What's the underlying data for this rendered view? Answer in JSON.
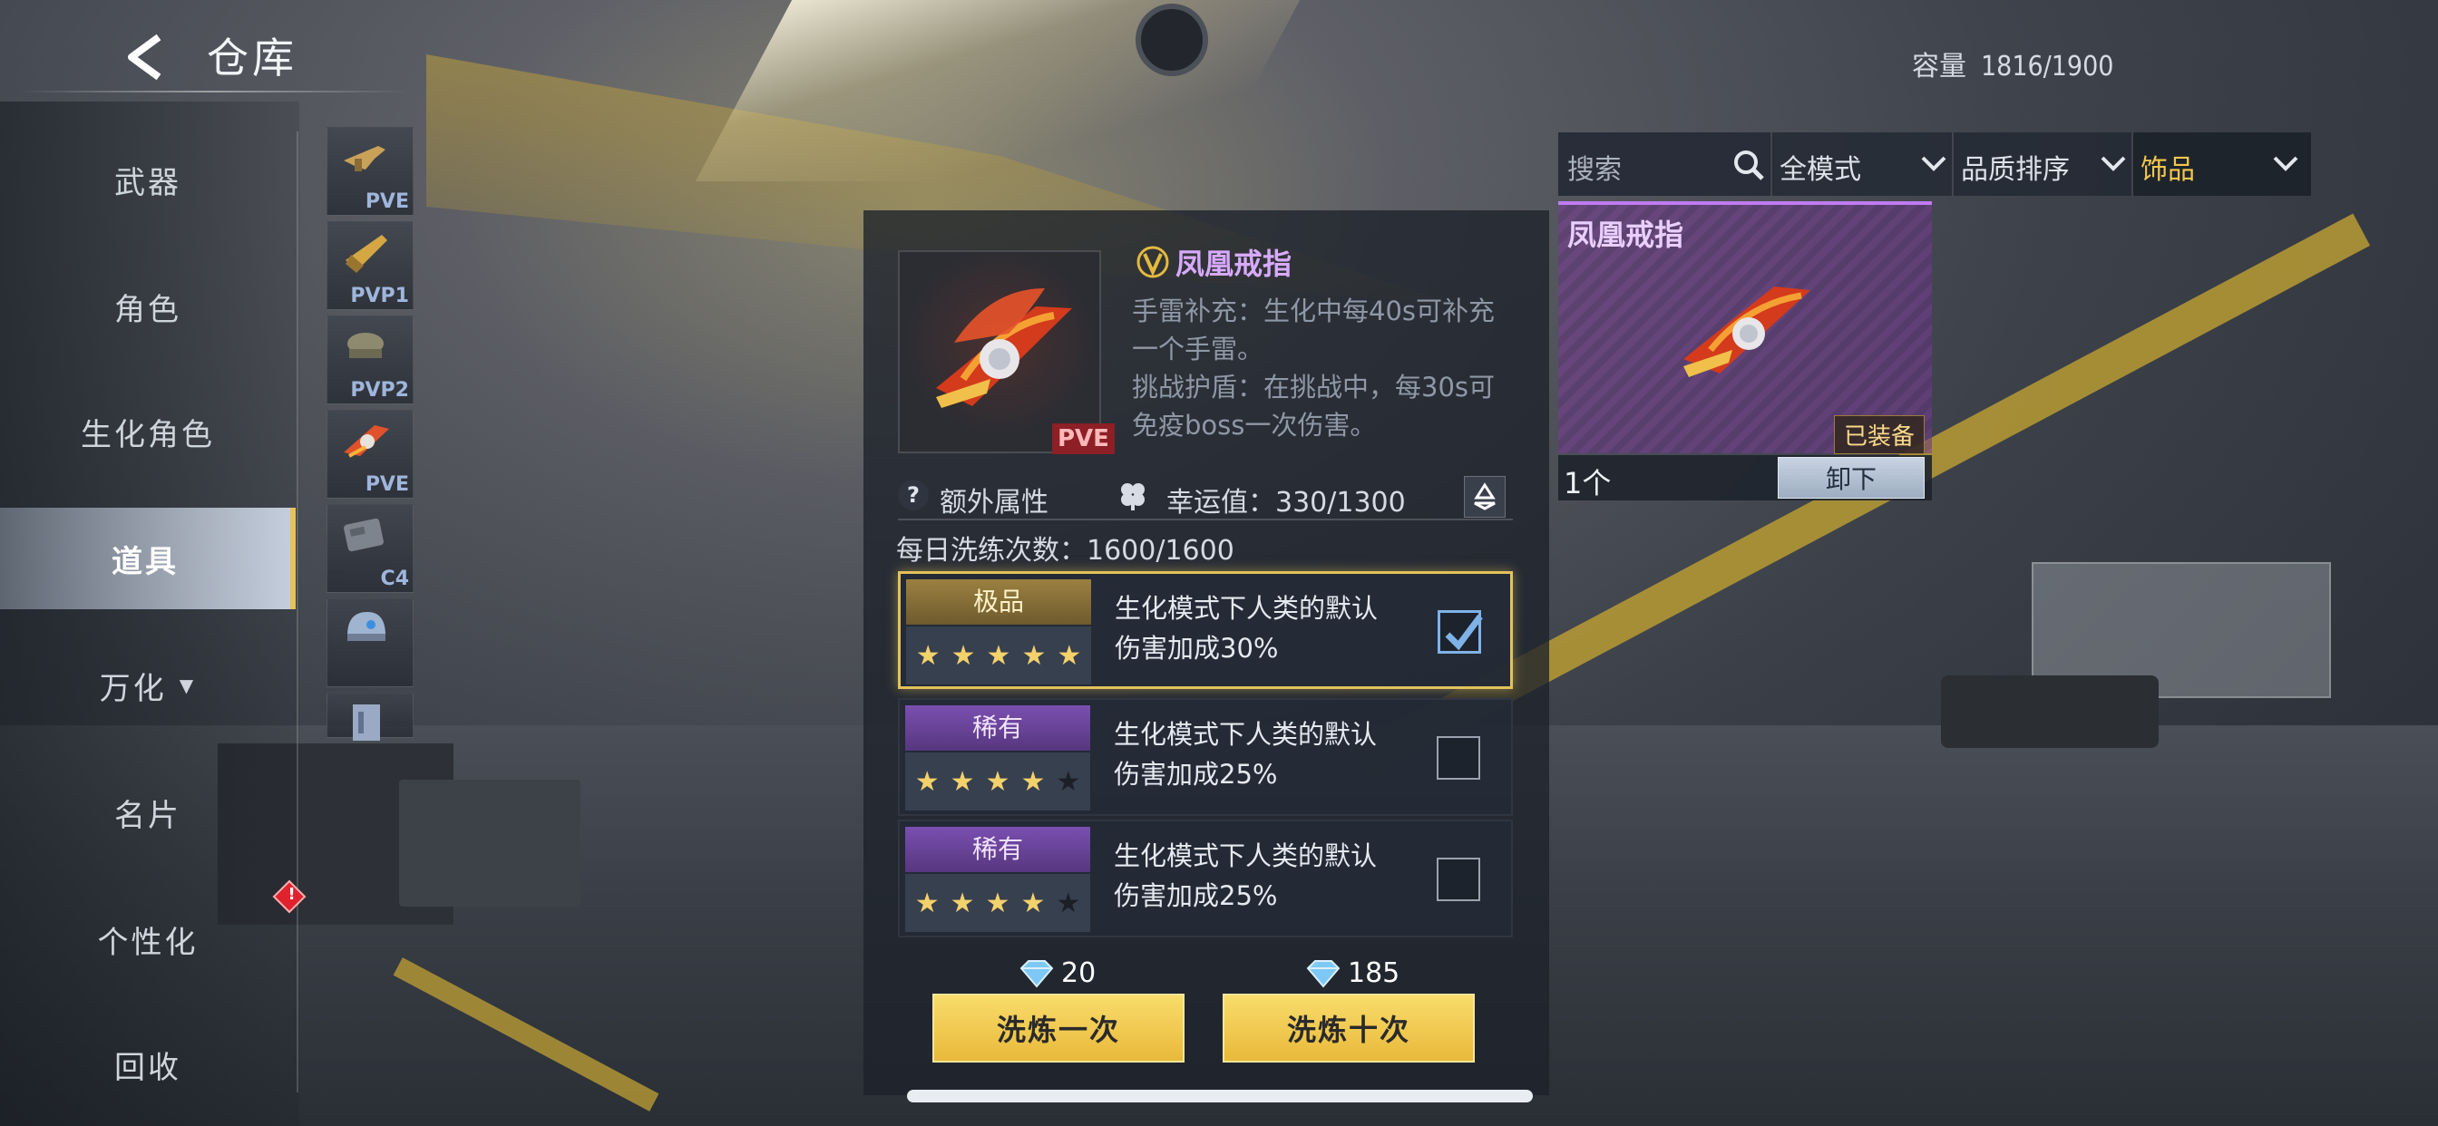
{
  "header": {
    "title": "仓库",
    "capacity_label": "容量",
    "capacity_value": "1816/1900"
  },
  "nav": {
    "items": [
      {
        "label": "武器"
      },
      {
        "label": "角色"
      },
      {
        "label": "生化角色"
      },
      {
        "label": "道具",
        "active": true
      },
      {
        "label": "万化"
      },
      {
        "label": "名片"
      },
      {
        "label": "个性化"
      },
      {
        "label": "回收"
      }
    ]
  },
  "strip": {
    "items": [
      {
        "label": "PVE",
        "icon": "weapon-icon"
      },
      {
        "label": "PVP1",
        "icon": "weapon-icon"
      },
      {
        "label": "PVP2",
        "icon": "weapon-icon"
      },
      {
        "label": "PVE",
        "icon": "ring-icon"
      },
      {
        "label": "C4",
        "icon": "c4-icon"
      },
      {
        "label": "",
        "icon": "helmet-icon"
      },
      {
        "label": "",
        "icon": "armor-icon"
      }
    ]
  },
  "detail": {
    "name": "凤凰戒指",
    "rank_mark": "V",
    "thumb_tag": "PVE",
    "desc_lines": [
      "手雷补充：生化中每40s可补充",
      "一个手雷。",
      "挑战护盾：在挑战中，每30s可",
      "免疫boss一次伤害。"
    ],
    "extra_attr_label": "额外属性",
    "luck_text": "幸运值：330/1300",
    "daily_text": "每日洗练次数：1600/1600",
    "options": [
      {
        "grade": "极品",
        "grade_color": "#9b8040",
        "stars": 5,
        "line1": "生化模式下人类的默认",
        "line2": "伤害加成30%",
        "checked": true
      },
      {
        "grade": "稀有",
        "grade_color": "#7a4fb0",
        "stars": 4,
        "line1": "生化模式下人类的默认",
        "line2": "伤害加成25%",
        "checked": false
      },
      {
        "grade": "稀有",
        "grade_color": "#7a4fb0",
        "stars": 4,
        "line1": "生化模式下人类的默认",
        "line2": "伤害加成25%",
        "checked": false
      }
    ],
    "cost_once": "20",
    "cost_ten": "185",
    "btn_once": "洗炼一次",
    "btn_ten": "洗炼十次"
  },
  "filters": {
    "search_placeholder": "搜索",
    "mode": "全模式",
    "sort": "品质排序",
    "category": "饰品"
  },
  "equipped": {
    "name": "凤凰戒指",
    "badge": "已装备",
    "quantity": "1个",
    "unequip_label": "卸下"
  },
  "colors": {
    "accent_gold": "#e9b93a",
    "epic_purple": "#c07bf2",
    "active_nav_border": "#e7c25a"
  }
}
